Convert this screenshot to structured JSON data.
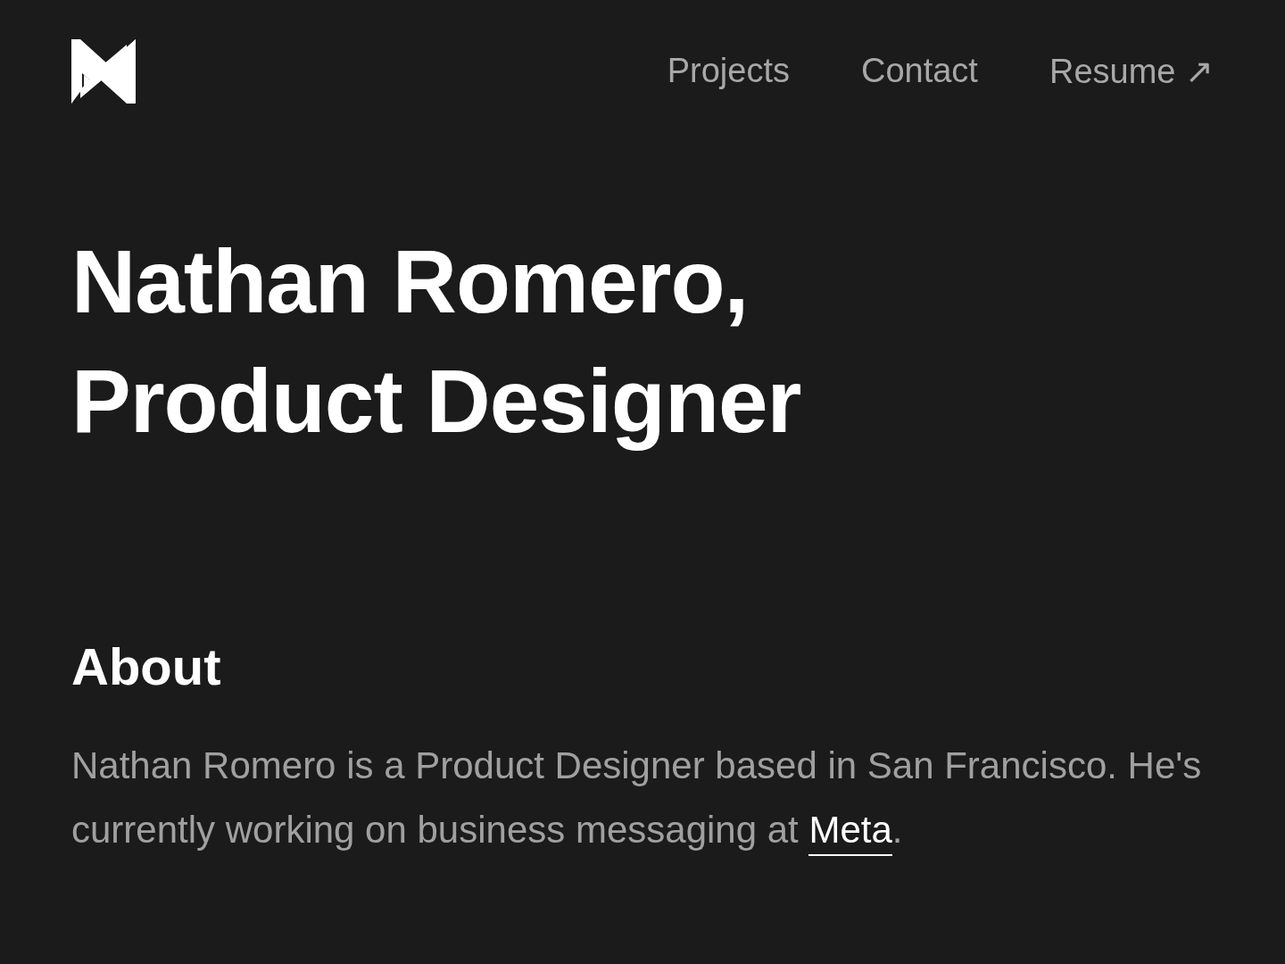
{
  "nav": {
    "links": [
      {
        "label": "Projects"
      },
      {
        "label": "Contact"
      },
      {
        "label": "Resume ↗"
      }
    ]
  },
  "hero": {
    "title_lines": [
      "Nathan Romero,",
      "Product Designer"
    ]
  },
  "about": {
    "heading": "About",
    "text": "Nathan Romero is a Product Designer based in San Francisco. He's currently working on business messaging at ",
    "link": "Meta",
    "end": "."
  }
}
